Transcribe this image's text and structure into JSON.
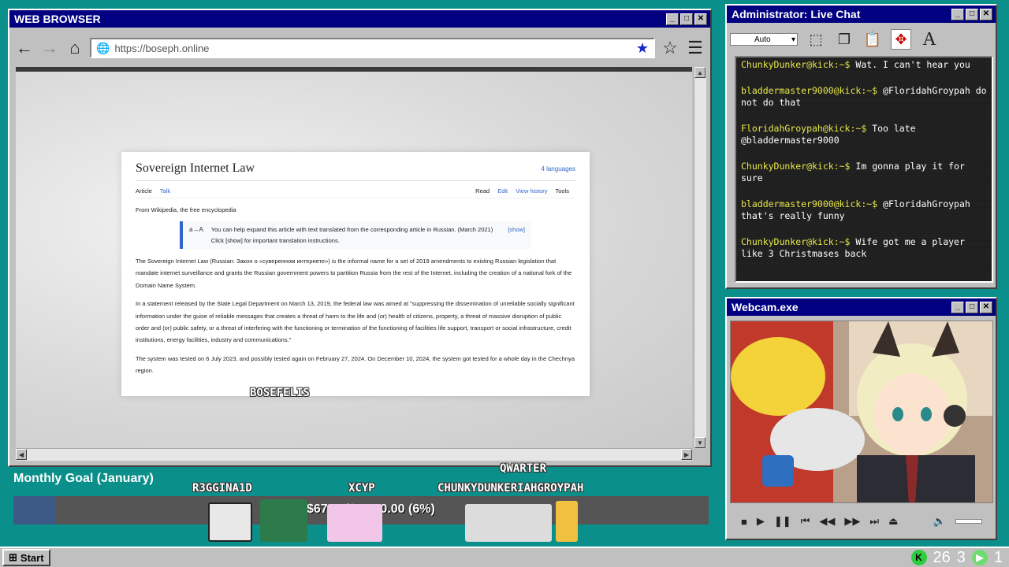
{
  "browser": {
    "title": "WEB BROWSER",
    "url": "https://boseph.online",
    "watermark": "BOSEFELIS"
  },
  "wiki": {
    "title": "Sovereign Internet Law",
    "languages": "4 languages",
    "tabs": [
      "Article",
      "Talk"
    ],
    "actions": [
      "Read",
      "Edit",
      "View history",
      "Tools"
    ],
    "from": "From Wikipedia, the free encyclopedia",
    "notice": "You can help expand this article with text translated from the corresponding article in Russian. (March 2021) Click [show] for important translation instructions.",
    "notice_show": "[show]",
    "p1": "The Sovereign Internet Law (Russian: Закон о «суверенном интернете») is the informal name for a set of 2019 amendments to existing Russian legislation that mandate internet surveillance and grants the Russian government powers to partition Russia from the rest of the Internet, including the creation of a national fork of the Domain Name System.",
    "p2": "In a statement released by the State Legal Department on March 13, 2019, the federal law was aimed at \"suppressing the dissemination of unreliable socially significant information under the guise of reliable messages that creates a threat of harm to the life and (or) health of citizens, property, a threat of massive disruption of public order and (or) public safety, or a threat of interfering with the functioning or termination of the functioning of facilities life support, transport or social infrastructure, credit institutions, energy facilities, industry and communications.\"",
    "p3": "The system was tested on 6 July 2023, and possibly tested again on February 27, 2024. On December 10, 2024, the system got tested for a whole day in the Chechnya region."
  },
  "chat": {
    "title": "Administrator: Live Chat",
    "select": "Auto",
    "messages": [
      {
        "user": "ChunkyDunker@kick:~$",
        "text": "Wat. I can't hear you"
      },
      {
        "user": "bladdermaster9000@kick:~$",
        "text": "@FloridahGroypah do not do that"
      },
      {
        "user": "FloridahGroypah@kick:~$",
        "text": "Too late @bladdermaster9000"
      },
      {
        "user": "ChunkyDunker@kick:~$",
        "text": "Im gonna play it for sure"
      },
      {
        "user": "bladdermaster9000@kick:~$",
        "text": "@FloridahGroypah that's really funny"
      },
      {
        "user": "ChunkyDunker@kick:~$",
        "text": "Wife got me a player like 3 Christmases back"
      }
    ]
  },
  "webcam": {
    "title": "Webcam.exe"
  },
  "goal": {
    "label": "Monthly Goal (January)",
    "text": "$67.00/$1,000.00 (6%)",
    "progress": 0.06
  },
  "chatters": [
    "R3GGINA1D",
    "XCYP",
    "QWARTER",
    "CHUNKYDUNKERIAHGROYPAH"
  ],
  "taskbar": {
    "start": "Start",
    "count1": "26",
    "count2": "3",
    "count3": "1"
  }
}
